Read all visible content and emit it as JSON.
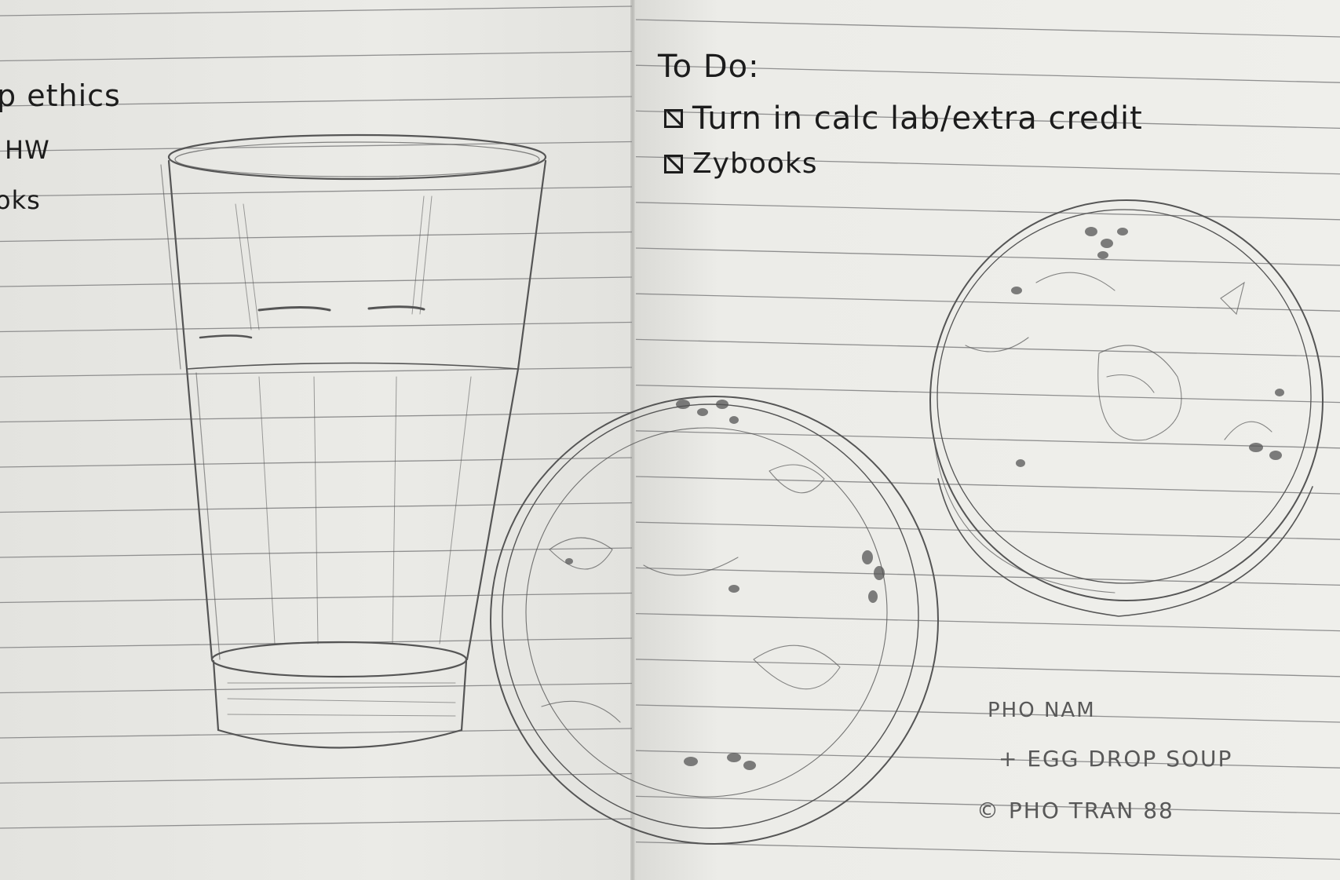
{
  "left_page": {
    "notes": [
      "p ethics",
      "HW",
      "oks"
    ]
  },
  "right_page": {
    "todo": {
      "title": "To Do:",
      "items": [
        {
          "label": "Turn in calc lab/extra credit",
          "checked": true
        },
        {
          "label": "Zybooks",
          "checked": true
        }
      ]
    },
    "caption": {
      "line1": "PHO NAM",
      "line2": "+ EGG DROP SOUP",
      "line3": "© PHO TRAN 88"
    }
  },
  "colors": {
    "paper": "#ebebe7",
    "rule": "#8f8f8f",
    "ink": "#1c1c1c",
    "pencil": "#6a6a6a"
  },
  "drawings": [
    "tall-glass-sketch",
    "soup-bowl-sketch-left",
    "soup-bowl-sketch-right"
  ]
}
